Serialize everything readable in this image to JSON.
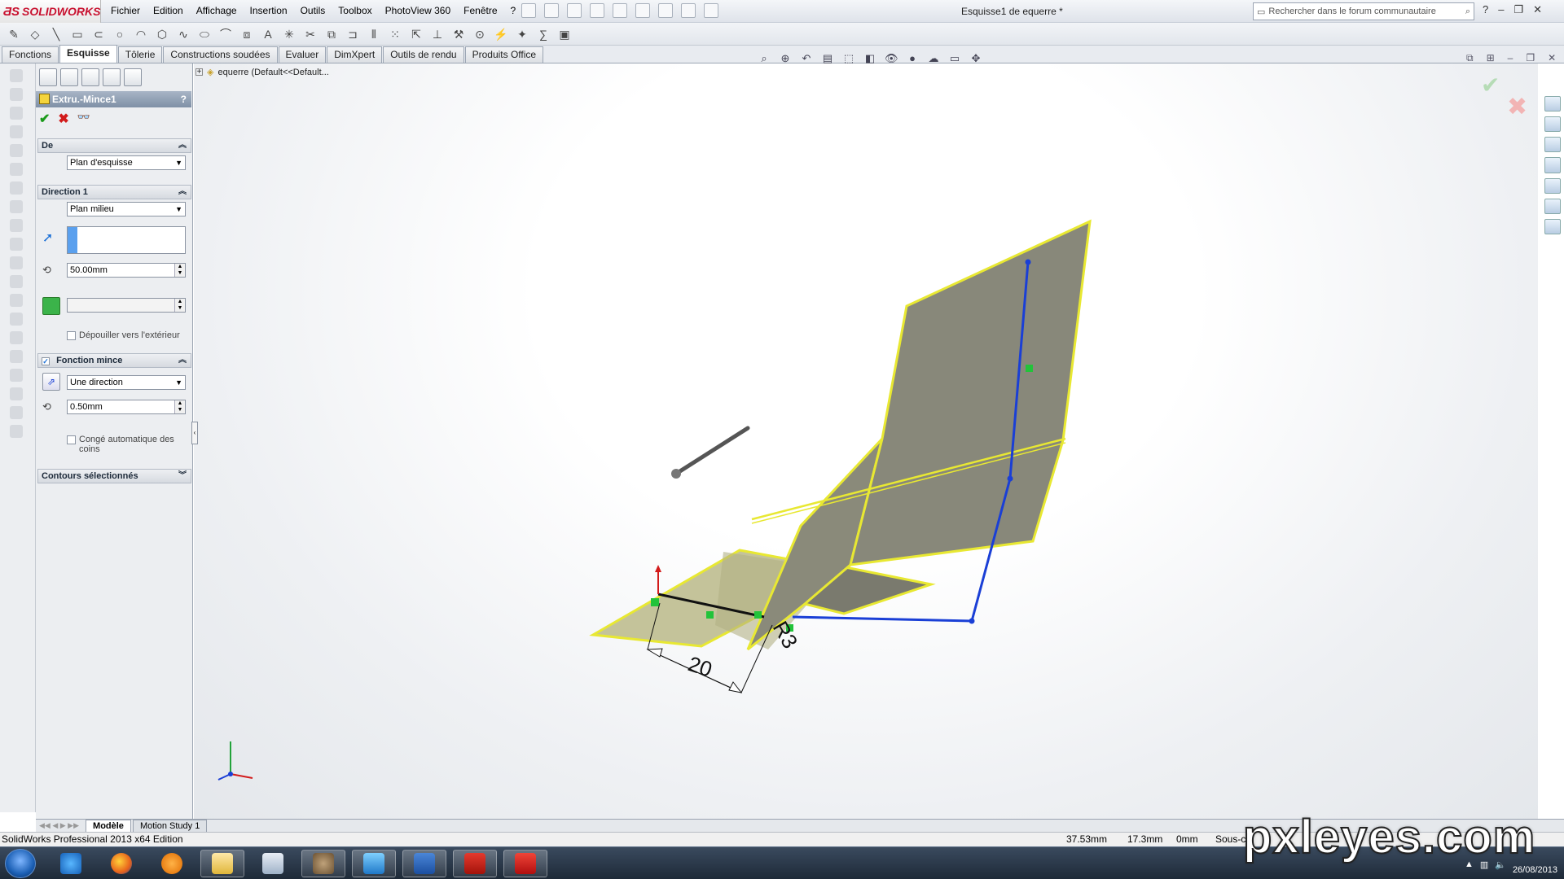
{
  "app": {
    "logo": "SOLIDWORKS",
    "document_title": "Esquisse1 de equerre *"
  },
  "menu": [
    "Fichier",
    "Edition",
    "Affichage",
    "Insertion",
    "Outils",
    "Toolbox",
    "PhotoView 360",
    "Fenêtre",
    "?"
  ],
  "search": {
    "placeholder": "Rechercher dans le forum communautaire"
  },
  "command_tabs": [
    {
      "label": "Fonctions",
      "active": false
    },
    {
      "label": "Esquisse",
      "active": true
    },
    {
      "label": "Tôlerie",
      "active": false
    },
    {
      "label": "Constructions soudées",
      "active": false
    },
    {
      "label": "Evaluer",
      "active": false
    },
    {
      "label": "DimXpert",
      "active": false
    },
    {
      "label": "Outils de rendu",
      "active": false
    },
    {
      "label": "Produits Office",
      "active": false
    }
  ],
  "property_manager": {
    "title": "Extru.-Mince1",
    "help": "?",
    "from": {
      "header": "De",
      "value": "Plan d'esquisse"
    },
    "direction1": {
      "header": "Direction 1",
      "end_condition": "Plan milieu",
      "depth": "50.00mm",
      "draft_outward_label": "Dépouiller vers l'extérieur",
      "draft_outward_checked": false
    },
    "thin_feature": {
      "header": "Fonction mince",
      "checked": true,
      "type": "Une direction",
      "thickness": "0.50mm",
      "auto_fillet_label": "Congé automatique des coins",
      "auto_fillet_checked": false
    },
    "selected_contours": {
      "header": "Contours sélectionnés"
    }
  },
  "feature_tree": {
    "root": "equerre  (Default<<Default..."
  },
  "viewport": {
    "dim_width": "20",
    "dim_radius": "R3"
  },
  "bottom_tabs": [
    {
      "label": "Modèle",
      "active": true
    },
    {
      "label": "Motion Study 1",
      "active": false
    }
  ],
  "status": {
    "edition": "SolidWorks Professional 2013 x64 Edition",
    "x": "37.53mm",
    "y": "17.3mm",
    "z": "0mm",
    "mode": "Sous-c"
  },
  "taskbar": {
    "date": "26/08/2013",
    "apps": [
      "internet-explorer",
      "firefox",
      "media-player",
      "file-explorer",
      "calculator",
      "gimp",
      "office-app",
      "word",
      "acrobat",
      "solidworks"
    ]
  },
  "watermark": "pxleyes.com",
  "colors": {
    "accent_blue": "#1a3fd6",
    "face_yellow": "#e8e832",
    "face_fill": "#8a8a7a",
    "ok_green": "#1a9a1a",
    "cancel_red": "#d21b1b"
  }
}
